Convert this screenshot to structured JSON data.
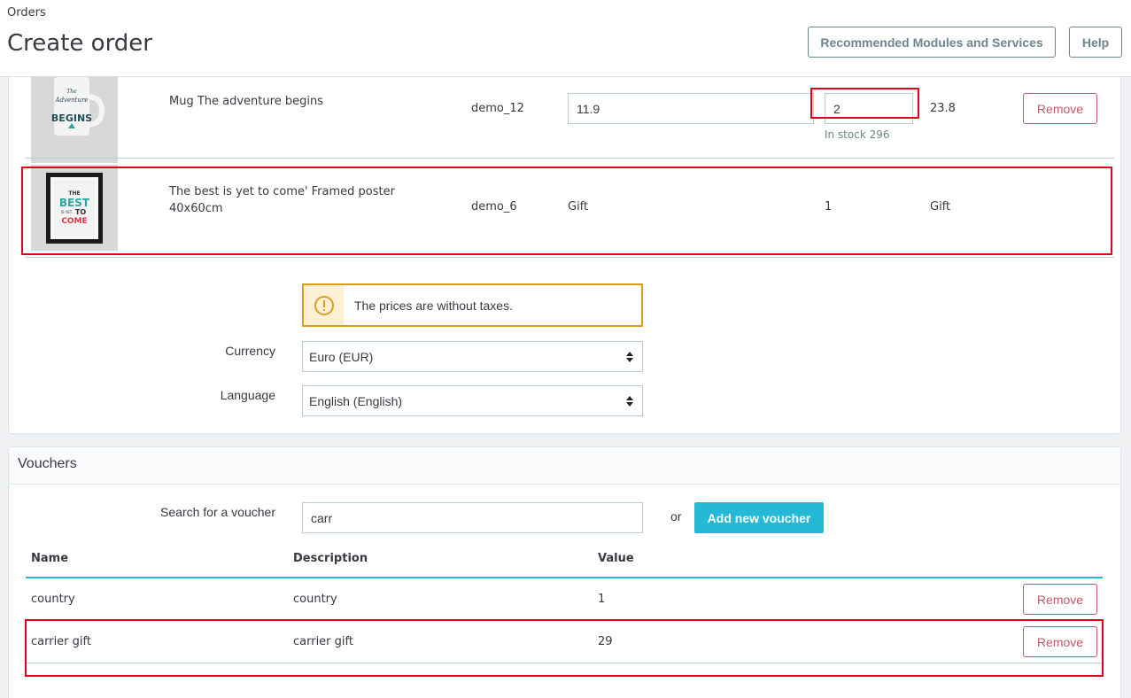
{
  "header": {
    "breadcrumb": "Orders",
    "title": "Create order",
    "modules_button": "Recommended Modules and Services",
    "help_button": "Help"
  },
  "cart": {
    "products": [
      {
        "name": "Mug The adventure begins",
        "reference": "demo_12",
        "price": "11.9",
        "quantity": "2",
        "stock": "In stock 296",
        "total": "23.8",
        "remove_label": "Remove",
        "thumb_text": [
          "The",
          "Adventure",
          "BEGINS"
        ]
      },
      {
        "name_line1": "The best is yet to come' Framed poster",
        "name_line2": "40x60cm",
        "reference": "demo_6",
        "price": "Gift",
        "quantity": "1",
        "total": "Gift",
        "thumb_text": [
          "THE",
          "BEST",
          "IS YET",
          "TO",
          "COME"
        ]
      }
    ],
    "alert": "The prices are without taxes.",
    "currency_label": "Currency",
    "currency_value": "Euro (EUR)",
    "language_label": "Language",
    "language_value": "English (English)"
  },
  "vouchers": {
    "title": "Vouchers",
    "search_label": "Search for a voucher",
    "search_value": "carr",
    "or_text": "or",
    "add_button": "Add new voucher",
    "columns": [
      "Name",
      "Description",
      "Value"
    ],
    "rows": [
      {
        "name": "country",
        "description": "country",
        "value": "1",
        "remove_label": "Remove"
      },
      {
        "name": "carrier gift",
        "description": "carrier gift",
        "value": "29",
        "remove_label": "Remove"
      }
    ]
  },
  "colors": {
    "primary": "#25b9d7",
    "danger": "#c05c67",
    "warning": "#d99d1d",
    "highlight": "#e0001a"
  }
}
